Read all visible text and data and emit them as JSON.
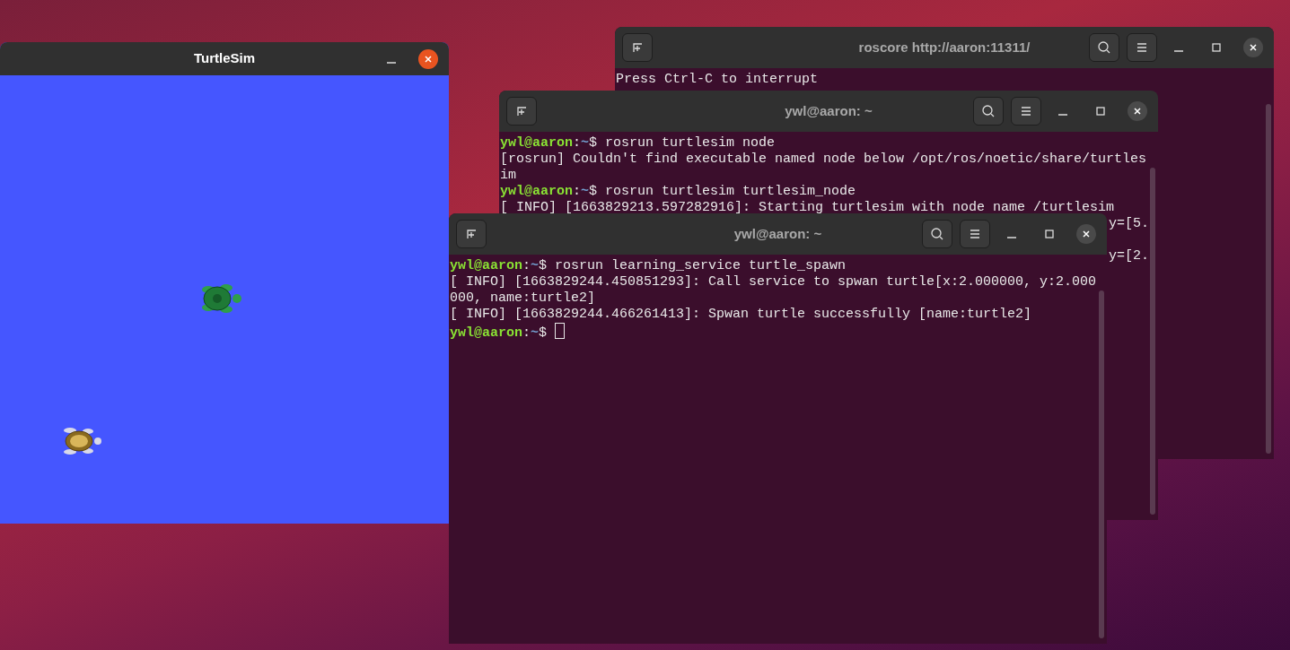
{
  "windows": [
    {
      "kind": "terminal",
      "title": "roscore http://aaron:11311/",
      "active": false,
      "lines": [
        {
          "kind": "output",
          "text": "Press Ctrl-C to interrupt"
        }
      ]
    },
    {
      "kind": "terminal",
      "title": "ywl@aaron: ~",
      "active": false,
      "lines": [
        {
          "kind": "prompt",
          "user": "ywl@aaron",
          "sep": ":",
          "path": "~",
          "symbol": "$",
          "command": "rosrun turtlesim node"
        },
        {
          "kind": "output",
          "text": "[rosrun] Couldn't find executable named node below /opt/ros/noetic/share/turtlesim"
        },
        {
          "kind": "prompt",
          "user": "ywl@aaron",
          "sep": ":",
          "path": "~",
          "symbol": "$",
          "command": "rosrun turtlesim turtlesim_node"
        },
        {
          "kind": "output",
          "text": "[ INFO] [1663829213.597282916]: Starting turtlesim with node name /turtlesim"
        },
        {
          "kind": "fragment",
          "text": "y=[5."
        },
        {
          "kind": "hidden"
        },
        {
          "kind": "fragment",
          "text": "y=[2."
        }
      ]
    },
    {
      "kind": "terminal",
      "title": "ywl@aaron: ~",
      "active": false,
      "lines": [
        {
          "kind": "prompt",
          "user": "ywl@aaron",
          "sep": ":",
          "path": "~",
          "symbol": "$",
          "command": "rosrun learning_service turtle_spawn"
        },
        {
          "kind": "output",
          "text": "[ INFO] [1663829244.450851293]: Call service to spwan turtle[x:2.000000, y:2.000000, name:turtle2]"
        },
        {
          "kind": "output",
          "text": "[ INFO] [1663829244.466261413]: Spwan turtle successfully [name:turtle2]"
        },
        {
          "kind": "prompt",
          "user": "ywl@aaron",
          "sep": ":",
          "path": "~",
          "symbol": "$",
          "cursor": true
        }
      ]
    },
    {
      "kind": "turtlesim",
      "title": "TurtleSim",
      "active": true,
      "turtles": [
        {
          "kind": "green"
        },
        {
          "kind": "tan"
        }
      ]
    }
  ]
}
